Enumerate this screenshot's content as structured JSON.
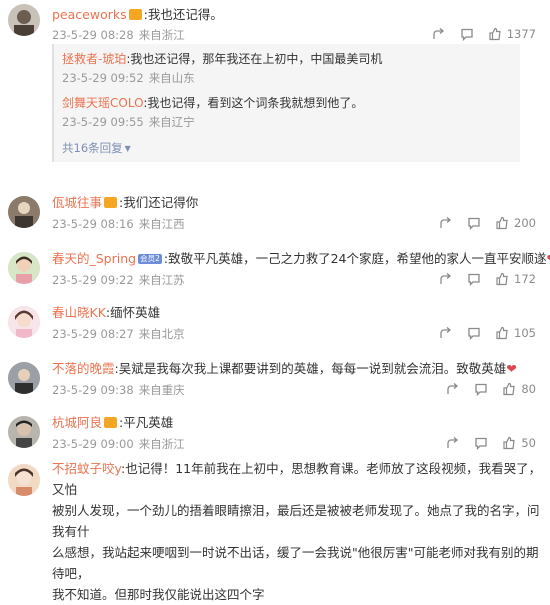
{
  "comments": [
    {
      "user": "peaceworks",
      "text": ":我也还记得。",
      "time": "23-5-29 08:28",
      "loc": "来自浙江",
      "likes": "1377",
      "replies": [
        {
          "user": "拯救者-琥珀",
          "text": ":我也还记得，那年我还在上初中，中国最美司机",
          "time": "23-5-29 09:52",
          "loc": "来自山东"
        },
        {
          "user": "剑舞天瑶COLO",
          "text": ":我也记得，看到这个词条我就想到他了。",
          "time": "23-5-29 09:55",
          "loc": "来自辽宁"
        }
      ],
      "more_replies": "共16条回复"
    },
    {
      "user": "佤城往事",
      "text": ":我们还记得你",
      "time": "23-5-29 08:16",
      "loc": "来自江西",
      "likes": "200"
    },
    {
      "user": "春天的_Spring",
      "vip": "会员2",
      "text": ":致敬平凡英雄，一己之力救了24个家庭，希望他的家人一直平安顺遂",
      "heart": "❤",
      "time": "23-5-29 09:22",
      "loc": "来自江苏",
      "likes": "172"
    },
    {
      "user": "春山晓KK",
      "text": ":缅怀英雄",
      "time": "23-5-29 08:27",
      "loc": "来自北京",
      "likes": "105"
    },
    {
      "user": "不落的晚霞",
      "text": ":吴斌是我每次我上课都要讲到的英雄，每每一说到就会流泪。致敬英雄",
      "heart": "❤",
      "time": "23-5-29 09:38",
      "loc": "来自重庆",
      "likes": "80"
    },
    {
      "user": "杭城阿良",
      "text": ":平凡英雄",
      "time": "23-5-29 09:00",
      "loc": "来自浙江",
      "likes": "50"
    },
    {
      "user": "不招蚊子咬y",
      "text_lines": [
        ":也记得！11年前我在上初中，思想教育课。老师放了这段视频，我看哭了，又怕",
        "被别人发现，一个劲儿的捂着眼睛擦泪，最后还是被被老师发现了。她点了我的名字，问我有什",
        "么感想，我站起来哽咽到一时说不出话，缓了一会我说\"他很厉害\"可能老师对我有别的期待吧，",
        "我不知道。但那时我仅能说出这四个字"
      ]
    }
  ],
  "colors": {
    "username": "#eb7350",
    "meta": "#999999",
    "more_link": "#7d8fb6",
    "heart": "#e0474c"
  }
}
